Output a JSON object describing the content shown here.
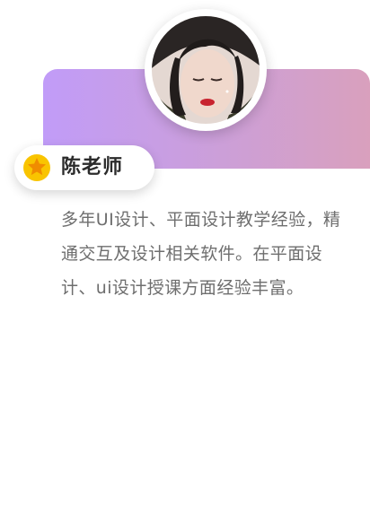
{
  "teacher": {
    "name": "陈老师",
    "bio": "多年UI设计、平面设计教学经验，精通交互及设计相关软件。在平面设计、ui设计授课方面经验丰富。"
  },
  "icons": {
    "badge": "star-badge-icon",
    "avatar": "teacher-avatar-photo"
  },
  "colors": {
    "banner_start": "#c19cf8",
    "banner_end": "#d9a0bd",
    "badge_outer": "#f9c400",
    "badge_star": "#f08c00",
    "name_text": "#2b2b2b",
    "bio_text": "#6e6e6e"
  }
}
